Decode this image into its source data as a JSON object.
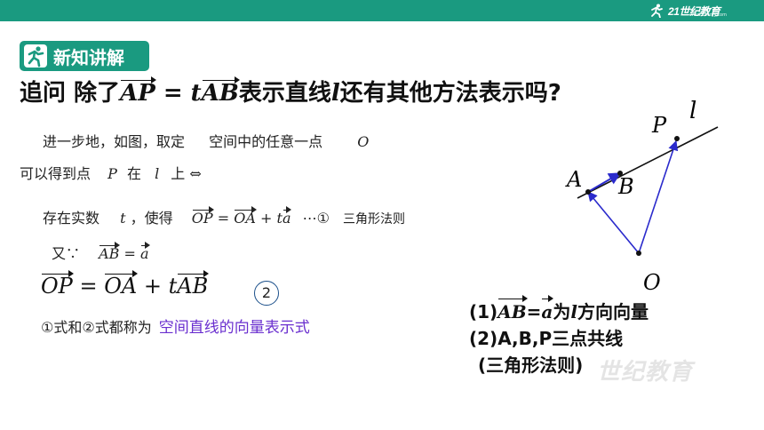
{
  "header": {
    "brand_text": "21世纪教育",
    "brand_url": "www.21cnjy.com"
  },
  "badge": {
    "label": "新知讲解"
  },
  "title": {
    "prefix": "追问 除了",
    "eq_v1": "AP",
    "eq_mid": " = t",
    "eq_v2": "AB",
    "suffix_a": "表示直线",
    "line_var": "l",
    "suffix_b": "还有其他方法表示吗?"
  },
  "content": {
    "line1_text": "进一步地，如图，取定",
    "line1_text2": "空间中的任意一点",
    "line1_var": "O",
    "line2_text": "可以得到点",
    "line2_var_p": "P",
    "line2_in": "在",
    "line2_var_l": "l",
    "line2_on": "上 ⇔",
    "line3_text": "存在实数",
    "line3_var": "t",
    "line3_text2": "，使得",
    "line3_v1": "OP",
    "line3_eq": "=",
    "line3_v2": "OA",
    "line3_plus": "+",
    "line3_t": "t",
    "line3_a": "a",
    "line3_tail": "⋯①",
    "line3_note": "三角形法则",
    "line4_text": "又∵",
    "line4_v": "AB",
    "line4_eq": "=",
    "line4_a": "a",
    "eq_big_v1": "OP",
    "eq_big_eq": " = ",
    "eq_big_v2": "OA",
    "eq_big_plus": " + t",
    "eq_big_v3": "AB",
    "circle_num": "2",
    "conclusion_text": "①式和②式都称为",
    "conclusion_highlight": "空间直线的向量表示式"
  },
  "right_notes": {
    "n1_prefix": "(1)",
    "n1_v": "AB",
    "n1_eq": "=",
    "n1_a": "a",
    "n1_text": "为",
    "n1_l": "l",
    "n1_text2": "方向向量",
    "n2": "(2)A,B,P三点共线",
    "n3": "(三角形法则)"
  },
  "figure": {
    "label_l": "l",
    "label_p": "P",
    "label_a": "A",
    "label_b": "B",
    "label_o": "O"
  },
  "watermark": "世纪教育",
  "colors": {
    "brand": "#1a9a80",
    "vector": "#2a2acc",
    "highlight": "#6a2fcf"
  }
}
